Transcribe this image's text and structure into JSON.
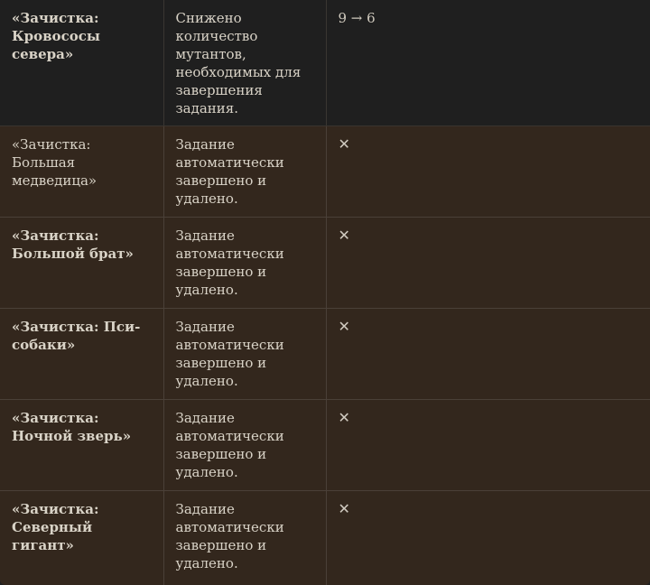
{
  "rows": [
    {
      "name": "«Зачистка: Кровососы севера»",
      "bold": true,
      "description": "Снижено количество мутантов, необходимых для завершения задания.",
      "change": "9 → 6",
      "is_cross": false,
      "theme": "dark"
    },
    {
      "name": "«Зачистка: Большая медведица»",
      "bold": false,
      "description": "Задание автоматически завершено и удалено.",
      "change": "✕",
      "is_cross": true,
      "theme": "brown"
    },
    {
      "name": "«Зачистка: Большой брат»",
      "bold": true,
      "description": "Задание автоматически завершено и удалено.",
      "change": "✕",
      "is_cross": true,
      "theme": "brown"
    },
    {
      "name": "«Зачистка: Пси-собаки»",
      "bold": true,
      "description": "Задание автоматически завершено и удалено.",
      "change": "✕",
      "is_cross": true,
      "theme": "brown"
    },
    {
      "name": "«Зачистка: Ночной зверь»",
      "bold": true,
      "description": "Задание автоматически завершено и удалено.",
      "change": "✕",
      "is_cross": true,
      "theme": "brown"
    },
    {
      "name": "«Зачистка: Северный гигант»",
      "bold": true,
      "description": "Задание автоматически завершено и удалено.",
      "change": "✕",
      "is_cross": true,
      "theme": "brown"
    }
  ]
}
